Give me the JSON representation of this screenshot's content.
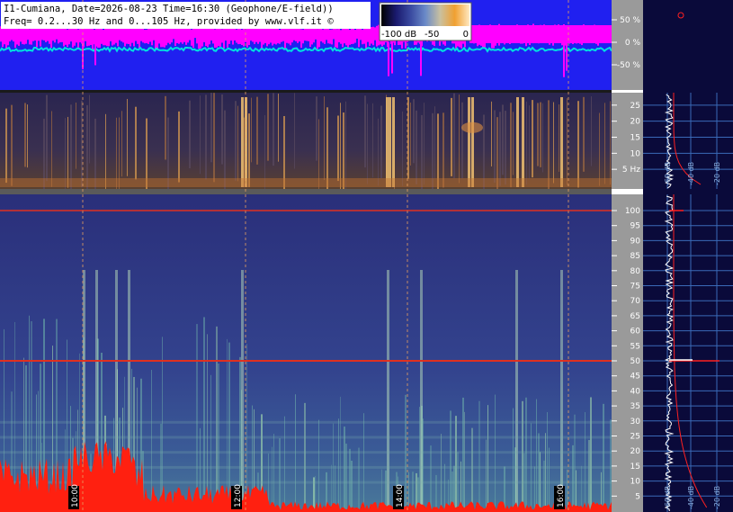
{
  "header": {
    "line1": "I1-Cumiana, Date=2026-08-23 Time=16:30 (Geophone/E-field))",
    "line2": "Freq= 0.2...30 Hz and 0...105 Hz, provided by www.vlf.it ©"
  },
  "colorbar": {
    "labels": [
      "-100 dB",
      "-50",
      "0"
    ],
    "stops": [
      "#000000",
      "#1a1a6e",
      "#3a4aa0",
      "#6a8ac8",
      "#c9c0a0",
      "#f0a030",
      "#ffe8c0"
    ]
  },
  "colors": {
    "top_bg": "#2020f0",
    "magenta": "#ff00ff",
    "cyan": "#00e0e0",
    "side_bg": "#0a0a3a",
    "scale_bg": "#9a9a9a",
    "grid_blue": "#3a6ab8",
    "hour_line": "#e8a060",
    "mains_line": "#e03020",
    "profile_white": "#ffffff",
    "profile_red": "#ff2020"
  },
  "chart_data": [
    {
      "type": "line",
      "panel": "amplitude",
      "y_tick_labels": [
        "50 %",
        "0 %",
        "-50 %"
      ],
      "ylim": [
        -100,
        100
      ],
      "unit": "%"
    },
    {
      "type": "heatmap",
      "panel": "low-frequency spectrogram",
      "y_tick_labels": [
        "25",
        "20",
        "15",
        "10",
        "5 Hz"
      ],
      "ylim": [
        0.2,
        30
      ],
      "profile_labels": [
        "-60 dB",
        "-40 dB",
        "-20 dB"
      ]
    },
    {
      "type": "heatmap",
      "panel": "full spectrogram",
      "y_tick_labels": [
        "100",
        "95",
        "90",
        "85",
        "80",
        "75",
        "70",
        "65",
        "60",
        "55",
        "50",
        "45",
        "40",
        "35",
        "30",
        "25",
        "20",
        "15",
        "10",
        "5"
      ],
      "ylim": [
        0,
        105
      ],
      "profile_labels": [
        "-60 dB",
        "-40 dB",
        "-20 dB"
      ],
      "time_labels": [
        "10:00",
        "12:00",
        "14:00",
        "16:00"
      ],
      "mains_hum_hz": 50,
      "line_100hz": 100
    }
  ]
}
